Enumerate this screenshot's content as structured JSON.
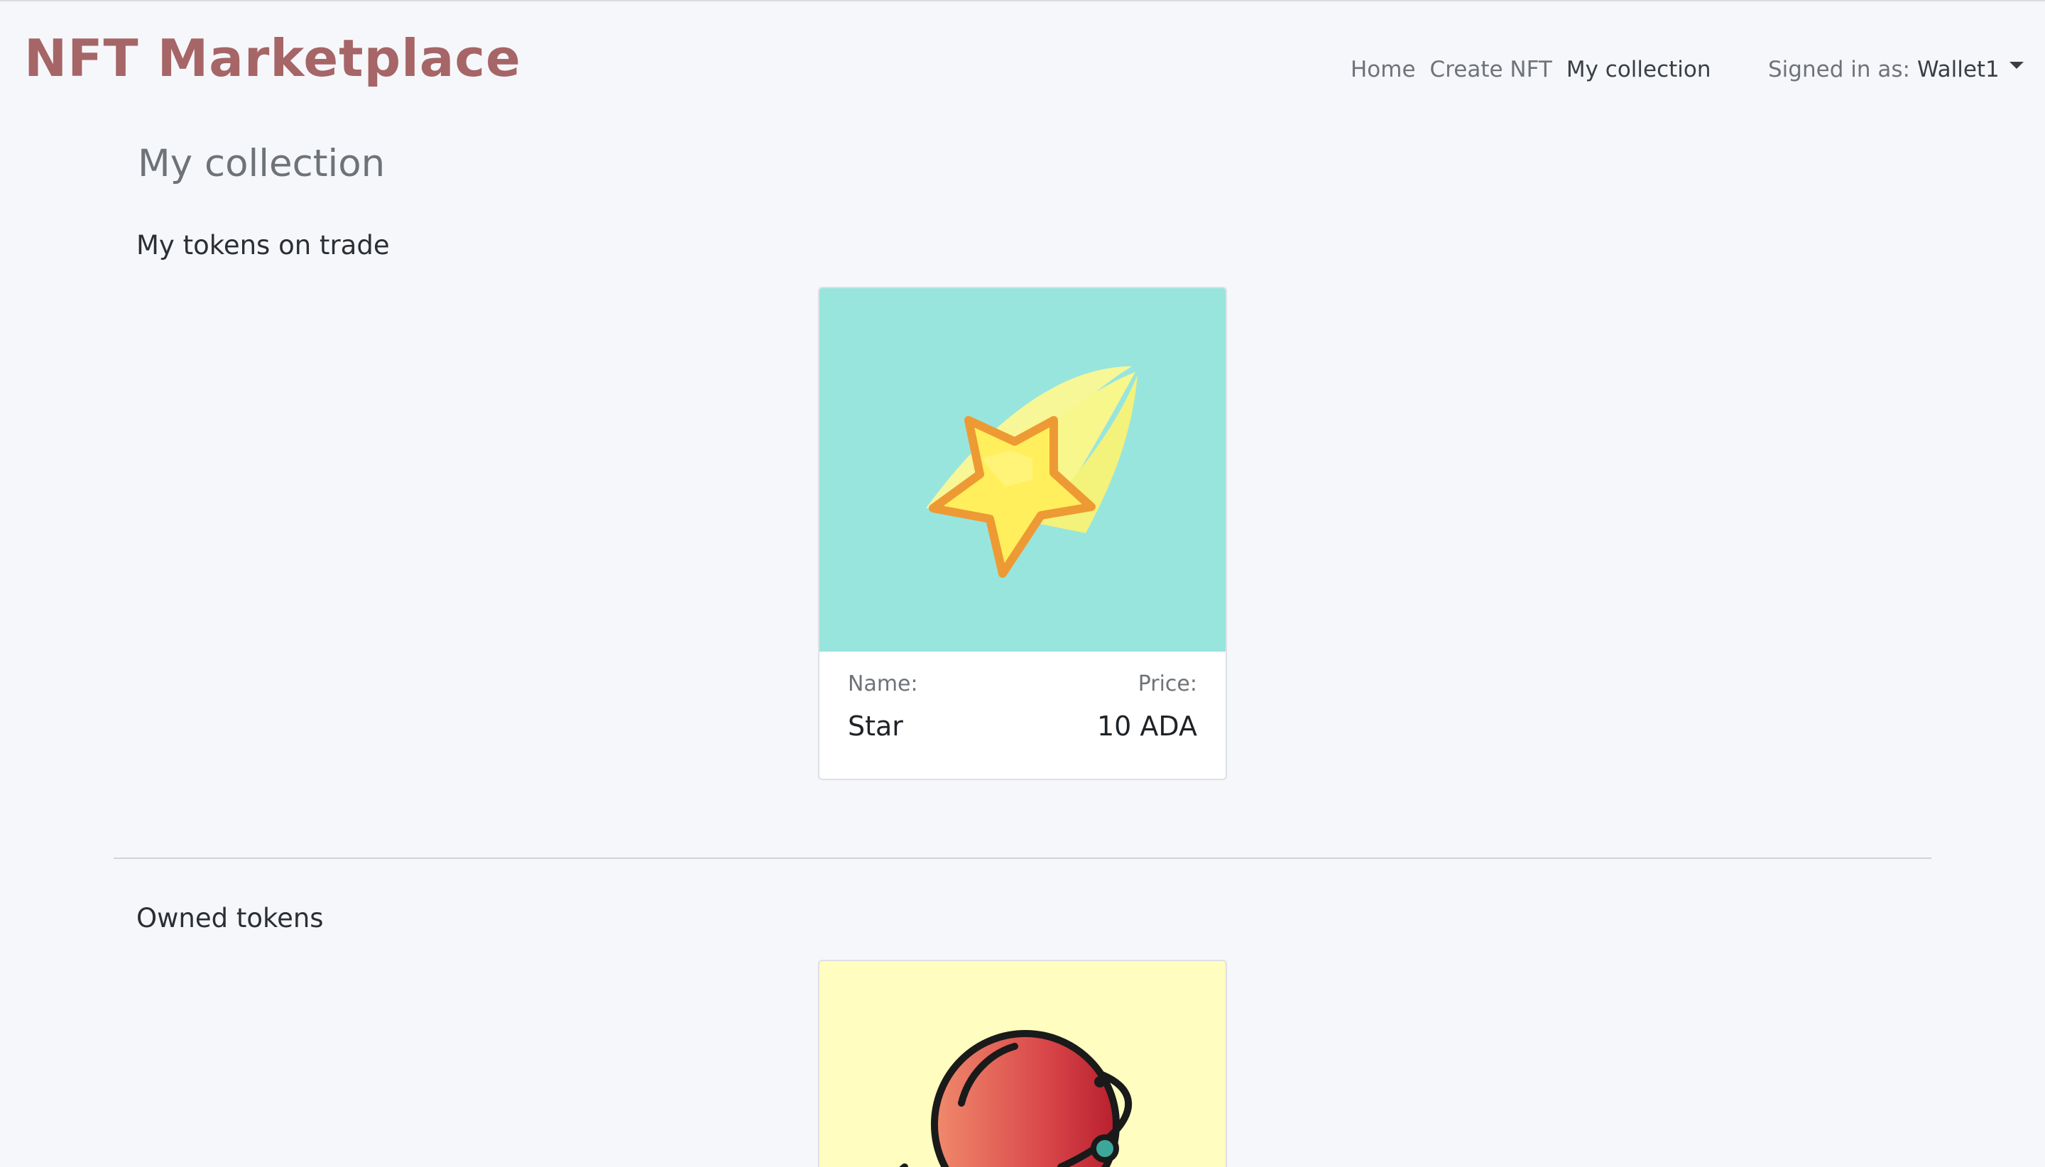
{
  "header": {
    "brand": "NFT Marketplace",
    "nav": [
      {
        "label": "Home",
        "active": false
      },
      {
        "label": "Create NFT",
        "active": false
      },
      {
        "label": "My collection",
        "active": true
      }
    ],
    "signed_in_label": "Signed in as:",
    "wallet": "Wallet1"
  },
  "main": {
    "title": "My collection",
    "on_trade": {
      "heading": "My tokens on trade",
      "items": [
        {
          "name_label": "Name:",
          "name": "Star",
          "price_label": "Price:",
          "price": "10 ADA",
          "image_icon": "shooting-star-icon",
          "bg_color": "#98e5de"
        }
      ]
    },
    "owned": {
      "heading": "Owned tokens",
      "items": [
        {
          "image_icon": "planet-icon",
          "bg_color": "#fffdc0"
        }
      ]
    }
  },
  "colors": {
    "brand": "#a66566",
    "background": "#f6f7fb"
  }
}
